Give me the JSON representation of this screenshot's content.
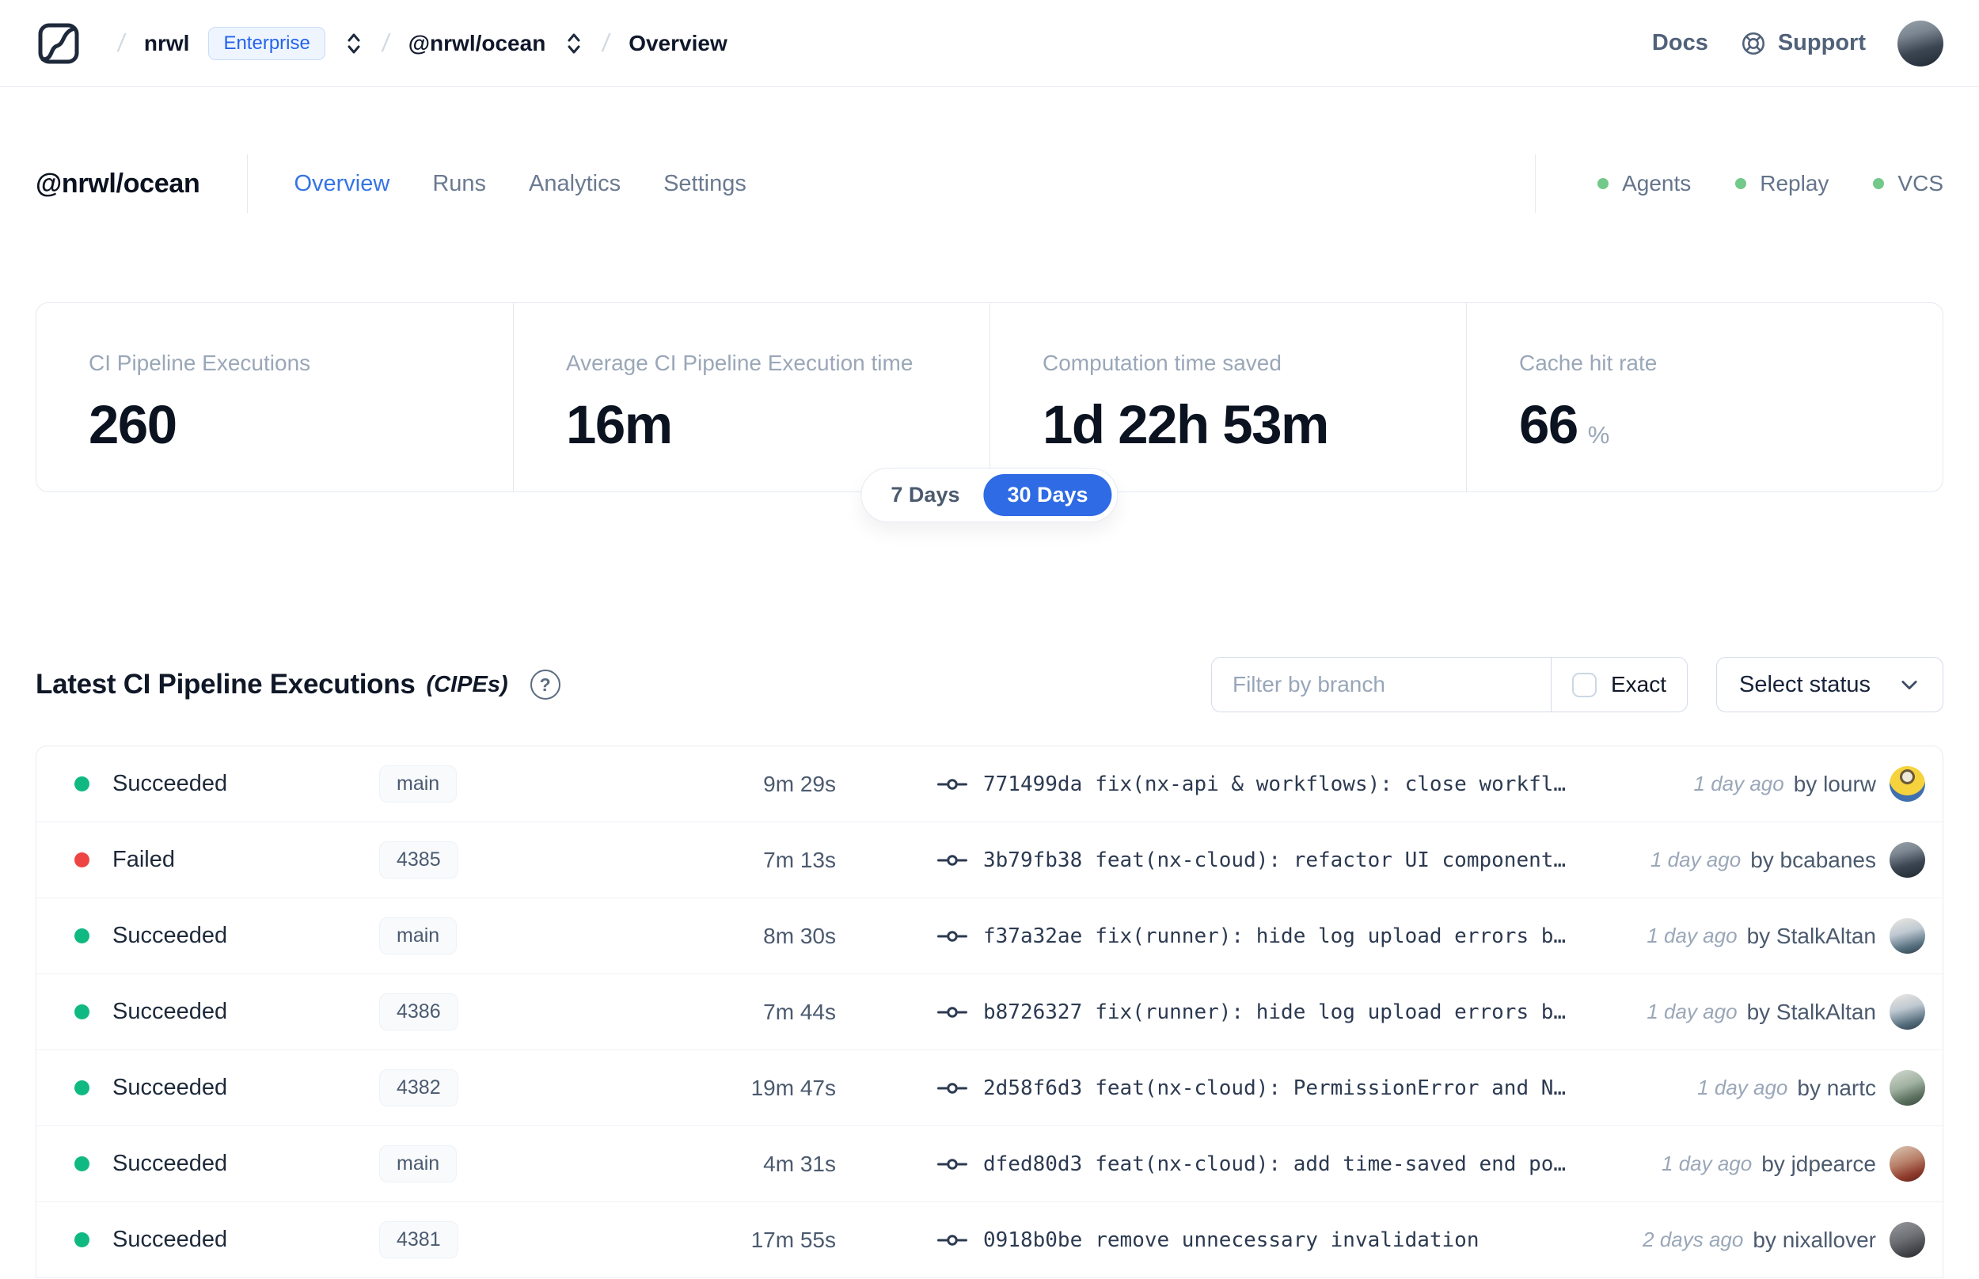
{
  "colors": {
    "accent_blue": "#2e6be4",
    "link_blue": "#3575e3",
    "success_green": "#10b981",
    "indicator_green": "#72c989",
    "failed_red": "#ef4444",
    "muted_gray": "#9aa7b8",
    "border_gray": "#e5eaf0"
  },
  "nav": {
    "breadcrumb": {
      "org": "nrwl",
      "org_badge": "Enterprise",
      "workspace": "@nrwl/ocean",
      "page": "Overview",
      "separator": "/"
    },
    "docs_label": "Docs",
    "support_label": "Support",
    "avatar": "photo-dark"
  },
  "header": {
    "title": "@nrwl/ocean",
    "tabs": [
      {
        "label": "Overview",
        "active": true
      },
      {
        "label": "Runs",
        "active": false
      },
      {
        "label": "Analytics",
        "active": false
      },
      {
        "label": "Settings",
        "active": false
      }
    ],
    "indicators": [
      {
        "label": "Agents"
      },
      {
        "label": "Replay"
      },
      {
        "label": "VCS"
      }
    ]
  },
  "stats": [
    {
      "label": "CI Pipeline Executions",
      "value": "260",
      "suffix": ""
    },
    {
      "label": "Average CI Pipeline Execution time",
      "value": "16m",
      "suffix": ""
    },
    {
      "label": "Computation time saved",
      "value": "1d 22h 53m",
      "suffix": ""
    },
    {
      "label": "Cache hit rate",
      "value": "66",
      "suffix": "%"
    }
  ],
  "range_toggle": {
    "options": [
      {
        "label": "7 Days",
        "active": false
      },
      {
        "label": "30 Days",
        "active": true
      }
    ]
  },
  "section": {
    "title": "Latest CI Pipeline Executions",
    "title_suffix": "(CIPEs)",
    "help": "?",
    "filter_placeholder": "Filter by branch",
    "exact_label": "Exact",
    "status_button_label": "Select status"
  },
  "table": {
    "rows": [
      {
        "status": "Succeeded",
        "branch": "main",
        "duration": "9m 29s",
        "hash": "771499da",
        "message": "fix(nx-api & workflows): close workfl…",
        "time": "1 day ago",
        "author": "by lourw",
        "avatar": "minion"
      },
      {
        "status": "Failed",
        "branch": "4385",
        "duration": "7m 13s",
        "hash": "3b79fb38",
        "message": "feat(nx-cloud): refactor UI component…",
        "time": "1 day ago",
        "author": "by bcabanes",
        "avatar": "photo-dark"
      },
      {
        "status": "Succeeded",
        "branch": "main",
        "duration": "8m 30s",
        "hash": "f37a32ae",
        "message": "fix(runner): hide log upload errors b…",
        "time": "1 day ago",
        "author": "by StalkAltan",
        "avatar": "photo-light"
      },
      {
        "status": "Succeeded",
        "branch": "4386",
        "duration": "7m 44s",
        "hash": "b8726327",
        "message": "fix(runner): hide log upload errors b…",
        "time": "1 day ago",
        "author": "by StalkAltan",
        "avatar": "photo-light"
      },
      {
        "status": "Succeeded",
        "branch": "4382",
        "duration": "19m 47s",
        "hash": "2d58f6d3",
        "message": "feat(nx-cloud): PermissionError and N…",
        "time": "1 day ago",
        "author": "by nartc",
        "avatar": "photo-green"
      },
      {
        "status": "Succeeded",
        "branch": "main",
        "duration": "4m 31s",
        "hash": "dfed80d3",
        "message": "feat(nx-cloud): add time-saved end po…",
        "time": "1 day ago",
        "author": "by jdpearce",
        "avatar": "photo-red"
      },
      {
        "status": "Succeeded",
        "branch": "4381",
        "duration": "17m 55s",
        "hash": "0918b0be",
        "message": "remove unnecessary invalidation",
        "time": "2 days ago",
        "author": "by nixallover",
        "avatar": "photo-gray"
      }
    ]
  }
}
